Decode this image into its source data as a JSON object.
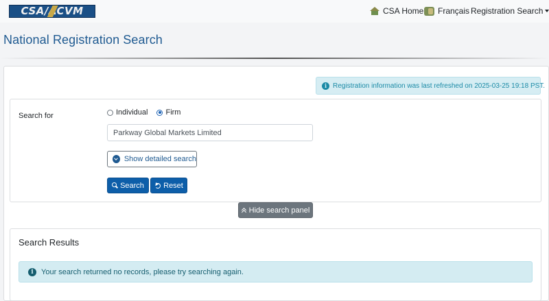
{
  "header": {
    "logo_text": "CSA/ACVM",
    "nav": {
      "home_label": "CSA Home",
      "home_icon": "house-icon",
      "language_label": "Français",
      "language_icon": "globe-icon",
      "registration_label": "Registration Search"
    }
  },
  "page": {
    "title": "National Registration Search"
  },
  "refresh_notice": {
    "text": "Registration information was last refreshed on 2025-03-25 19:18 PST."
  },
  "search_form": {
    "search_for_label": "Search for",
    "options": [
      {
        "label": "Individual",
        "checked": false
      },
      {
        "label": "Firm",
        "checked": true
      }
    ],
    "name_value": "Parkway Global Markets Limited",
    "detailed_search_label": "Show detailed search",
    "search_label": "Search",
    "reset_label": "Reset"
  },
  "hide_panel_label": "Hide search panel",
  "results": {
    "title": "Search Results",
    "message": "Your search returned no records, please try searching again."
  },
  "colors": {
    "brand_blue": "#1f5a91",
    "primary_button": "#0d5ea9",
    "secondary_button": "#6c757d",
    "info_bg": "#d4ecf2",
    "info_text": "#155d6e"
  }
}
